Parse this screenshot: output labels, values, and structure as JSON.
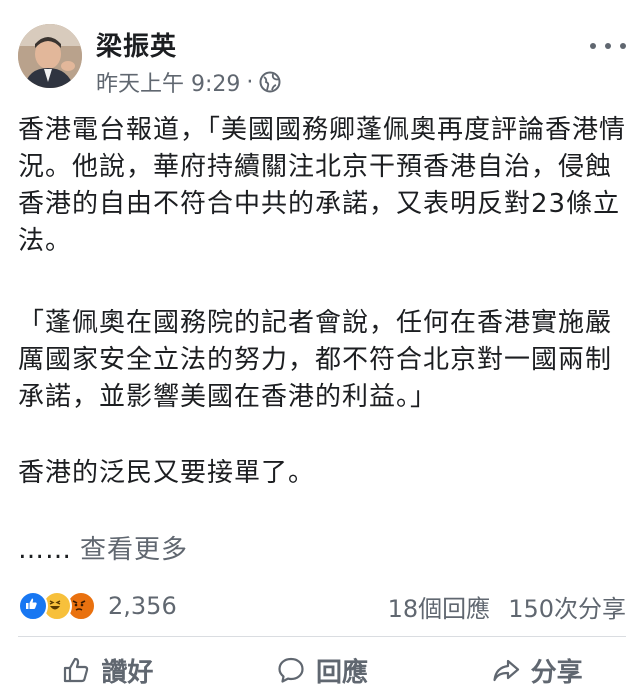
{
  "author": {
    "name": "梁振英",
    "timestamp": "昨天上午 9:29",
    "separator": "·"
  },
  "post": {
    "paragraph_1": "香港電台報道，「美國國務卿蓬佩奧再度評論香港情況。他說，華府持續關注北京干預香港自治，侵蝕香港的自由不符合中共的承諾，又表明反對23條立法。",
    "paragraph_2": "「蓬佩奧在國務院的記者會說，任何在香港實施嚴厲國家安全立法的努力，都不符合北京對一國兩制承諾，並影響美國在香港的利益。」",
    "paragraph_3": "香港的泛民又要接單了。",
    "ellipsis": "……",
    "see_more": "查看更多"
  },
  "engagement": {
    "reaction_icons": [
      "like-icon",
      "haha-icon",
      "angry-icon"
    ],
    "reaction_count": "2,356",
    "comments": "18個回應",
    "shares": "150次分享"
  },
  "actions": {
    "like": "讚好",
    "comment": "回應",
    "share": "分享"
  },
  "colors": {
    "like_blue": "#1877f2",
    "haha_yellow": "#f7c03b",
    "angry_orange": "#e9710f",
    "secondary_text": "#606770"
  }
}
